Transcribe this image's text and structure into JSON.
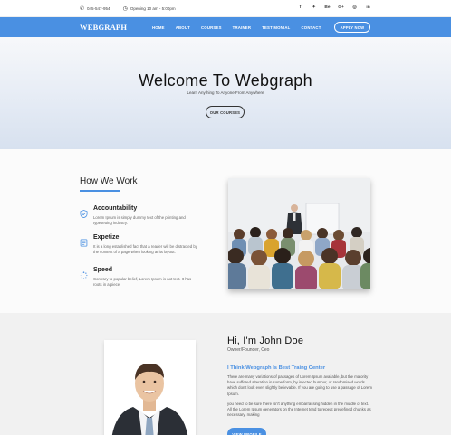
{
  "topbar": {
    "phone": "045-547-954",
    "hours": "Opening 10 am - 5:00pm",
    "social": [
      "f",
      "✦",
      "Be",
      "G+",
      "◎",
      "in"
    ]
  },
  "nav": {
    "logo": "WEBGRAPH",
    "items": [
      "HOME",
      "ABOUT",
      "COURSES",
      "TRAINER",
      "TESTIMONIAL",
      "CONTACT"
    ],
    "apply_label": "APPLY NOW"
  },
  "hero": {
    "title": "Welcome To Webgraph",
    "subtitle": "Learn Anything To Anyone From Anywhere",
    "button": "OUR COURSES"
  },
  "how": {
    "title": "How We Work",
    "features": [
      {
        "icon": "shield-icon",
        "title": "Accountability",
        "text": "Lorem Ipsum is simply dummy text of the printing and typesetting industry."
      },
      {
        "icon": "document-icon",
        "title": "Expetize",
        "text": "It is a long established fact that a reader will be distracted by the content of a page when looking at its layout."
      },
      {
        "icon": "spinner-icon",
        "title": "Speed",
        "text": "Contrary to popular belief, Lorem Ipsum is not text. It has roots in a piece."
      }
    ]
  },
  "about": {
    "name": "Hi, I'm John Doe",
    "role": "Owner/Founder, Ceo",
    "heading": "I Think Webgraph Is Best Traing Center",
    "para1": "There are many variations of passages of Lorem Ipsum available, but the majority have suffered alteration in some form, by injected humour, or randomised words which don't look even slightly believable. If you are going to use a passage of Lorem Ipsum.",
    "para2": "you need to be sure there isn't anything embarrassing hidden in the middle of text. All the Lorem Ipsum generators on the Internet tend to repeat predefined chunks as necessary, making",
    "button": "VIEW PROFILE"
  },
  "colors": {
    "accent": "#4a90e2"
  }
}
